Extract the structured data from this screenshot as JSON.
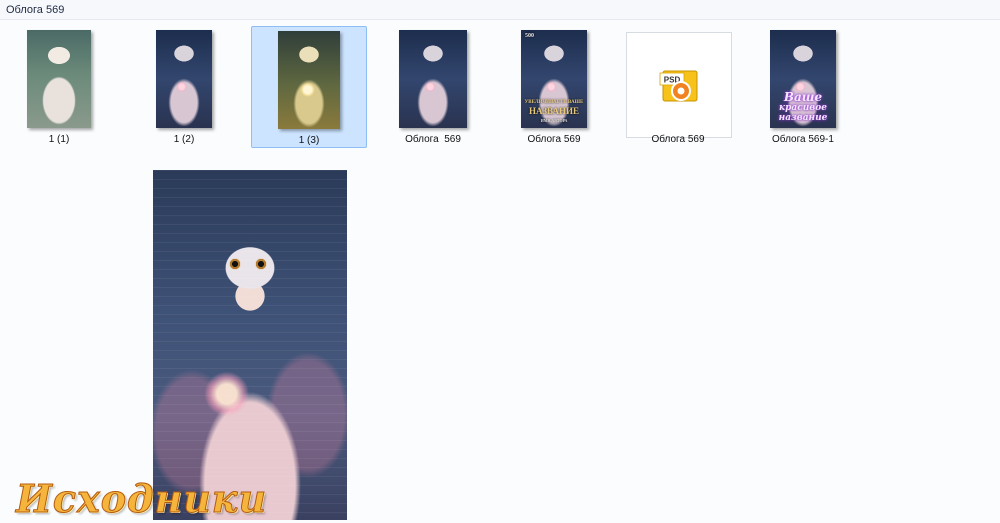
{
  "window": {
    "title": "Облога 569"
  },
  "files": [
    {
      "name": "1 (1)",
      "type": "image",
      "icon": "portrait-thumbnail"
    },
    {
      "name": "1 (2)",
      "type": "image",
      "icon": "portrait-thumbnail"
    },
    {
      "name": "1 (3)",
      "type": "image",
      "icon": "portrait-thumbnail",
      "selected": true
    },
    {
      "name": "Облога  569",
      "type": "image",
      "icon": "portrait-thumbnail"
    },
    {
      "name": "Облога 569",
      "type": "image",
      "icon": "book-cover-thumbnail",
      "cover_top_text": "500",
      "cover_text": [
        "УВЕЛИЧИВАЕТЕ ВАШЕ",
        "НАЗВАНИЕ",
        "ИМЯ АВТОРА"
      ]
    },
    {
      "name": "Облога 569",
      "type": "psd",
      "icon": "psd-file-icon",
      "badge": "PSD"
    },
    {
      "name": "Облога 569-1",
      "type": "image",
      "icon": "book-cover-thumbnail",
      "cover_text": [
        "Ваше",
        "красивое",
        "название"
      ]
    }
  ],
  "watermark": "Исходники",
  "colors": {
    "selection_bg": "#cce4ff",
    "selection_border": "#8fbef5",
    "psd_yellow": "#f7c21a",
    "psd_orange": "#f0831f",
    "watermark": "#f5b53c"
  }
}
